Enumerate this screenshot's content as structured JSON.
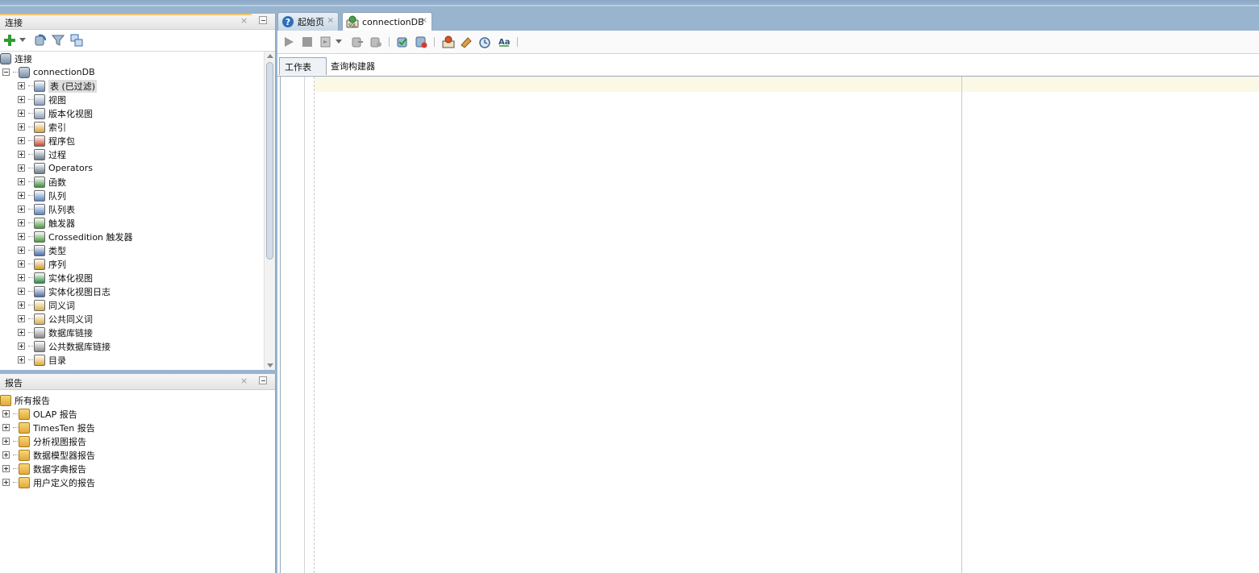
{
  "connections_panel": {
    "title": "连接",
    "close_glyph": "×",
    "tree_root": "连接",
    "connection": "connectionDB",
    "items": [
      {
        "label": "表 (已过滤)",
        "icon": "table-icon",
        "color": "#6f8fb6"
      },
      {
        "label": "视图",
        "icon": "view-icon",
        "color": "#8aa1bd"
      },
      {
        "label": "版本化视图",
        "icon": "editioned-view-icon",
        "color": "#8aa1bd"
      },
      {
        "label": "索引",
        "icon": "index-icon",
        "color": "#d9a63a"
      },
      {
        "label": "程序包",
        "icon": "package-icon",
        "color": "#c94a2c"
      },
      {
        "label": "过程",
        "icon": "procedure-icon",
        "color": "#6c7c8c"
      },
      {
        "label": "Operators",
        "icon": "operator-icon",
        "color": "#6c7c8c"
      },
      {
        "label": "函数",
        "icon": "function-icon",
        "color": "#3f8f3f"
      },
      {
        "label": "队列",
        "icon": "queue-icon",
        "color": "#5a84c4"
      },
      {
        "label": "队列表",
        "icon": "queue-table-icon",
        "color": "#5a84c4"
      },
      {
        "label": "触发器",
        "icon": "trigger-icon",
        "color": "#4a9a3a"
      },
      {
        "label": "Crossedition 触发器",
        "icon": "crossedition-trigger-icon",
        "color": "#4a9a3a"
      },
      {
        "label": "类型",
        "icon": "type-icon",
        "color": "#4c6fa8"
      },
      {
        "label": "序列",
        "icon": "sequence-icon",
        "color": "#d39b2a"
      },
      {
        "label": "实体化视图",
        "icon": "materialized-view-icon",
        "color": "#2f8b46"
      },
      {
        "label": "实体化视图日志",
        "icon": "materialized-view-log-icon",
        "color": "#4c6fa8"
      },
      {
        "label": "同义词",
        "icon": "synonym-icon",
        "color": "#d9b34a"
      },
      {
        "label": "公共同义词",
        "icon": "public-synonym-icon",
        "color": "#d9b34a"
      },
      {
        "label": "数据库链接",
        "icon": "database-link-icon",
        "color": "#8a8a8a"
      },
      {
        "label": "公共数据库链接",
        "icon": "public-database-link-icon",
        "color": "#8a8a8a"
      },
      {
        "label": "目录",
        "icon": "directory-icon",
        "color": "#e2a93a"
      }
    ]
  },
  "reports_panel": {
    "title": "报告",
    "close_glyph": "×",
    "root": "所有报告",
    "items": [
      {
        "label": "OLAP 报告"
      },
      {
        "label": "TimesTen 报告"
      },
      {
        "label": "分析视图报告"
      },
      {
        "label": "数据模型器报告"
      },
      {
        "label": "数据字典报告"
      },
      {
        "label": "用户定义的报告"
      }
    ]
  },
  "tabs": [
    {
      "label": "起始页",
      "icon": "help-icon",
      "close": "×"
    },
    {
      "label": "connectionDB",
      "icon": "sql-worksheet-icon",
      "close": "×"
    }
  ],
  "editor": {
    "subtabs": [
      "工作表",
      "查询构建器"
    ]
  },
  "colors": {
    "accent": "#98b4cf",
    "current_line": "#fbf8e6",
    "panel_highlight": "#f7c46b"
  }
}
